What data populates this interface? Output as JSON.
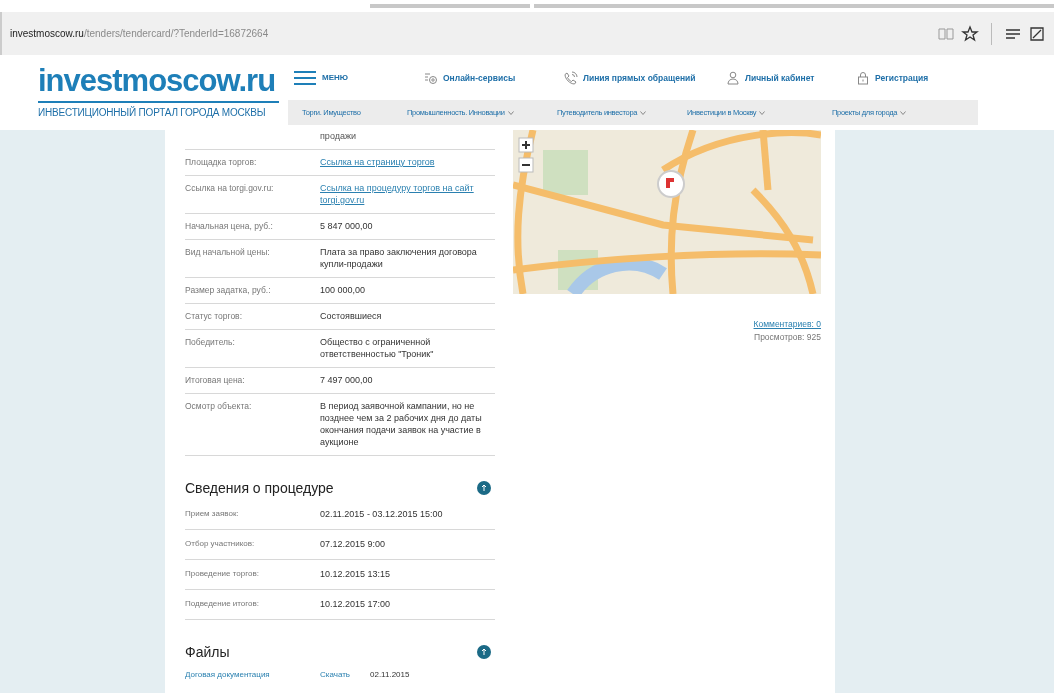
{
  "browser": {
    "url_host": "investmoscow.ru",
    "url_path": "/tenders/tendercard/?TenderId=16872664"
  },
  "header": {
    "logo": "investmoscow.ru",
    "tagline": "ИНВЕСТИЦИОННЫЙ ПОРТАЛ ГОРОДА МОСКВЫ",
    "menu_label": "МЕНЮ",
    "top_links": [
      {
        "kind": "services",
        "label": "Онлайн-сервисы"
      },
      {
        "kind": "phone",
        "label": "Линия прямых обращений"
      },
      {
        "kind": "user",
        "label": "Личный кабинет"
      },
      {
        "kind": "lock",
        "label": "Регистрация"
      }
    ],
    "nav": [
      {
        "label": "Торги. Имущество",
        "dropdown": false
      },
      {
        "label": "Промышленность. Инновации",
        "dropdown": true
      },
      {
        "label": "Путеводитель инвестора",
        "dropdown": true
      },
      {
        "label": "Инвестиции в Москву",
        "dropdown": true
      },
      {
        "label": "Проекты для города",
        "dropdown": true
      }
    ]
  },
  "details": [
    {
      "value": "продажи",
      "kind": "text"
    },
    {
      "label": "Площадка торгов:",
      "value": "Ссылка на страницу торгов",
      "kind": "link"
    },
    {
      "label": "Ссылка на torgi.gov.ru:",
      "value": "Ссылка на процедуру торгов на сайт torgi.gov.ru",
      "kind": "link"
    },
    {
      "label": "Начальная цена, руб.:",
      "value": "5 847 000,00",
      "kind": "text"
    },
    {
      "label": "Вид начальной цены:",
      "value": "Плата за право заключения договора купли-продажи",
      "kind": "text"
    },
    {
      "label": "Размер задатка, руб.:",
      "value": "100 000,00",
      "kind": "text"
    },
    {
      "label": "Статус торгов:",
      "value": "Состоявшиеся",
      "kind": "text"
    },
    {
      "label": "Победитель:",
      "value": "Общество с ограниченной ответственностью \"Троник\"",
      "kind": "text"
    },
    {
      "label": "Итоговая цена:",
      "value": "7 497 000,00",
      "kind": "text"
    },
    {
      "label": "Осмотр объекта:",
      "value": "В период заявочной кампании, но не позднее чем за 2 рабочих дня до даты окончания подачи заявок на участие в аукционе",
      "kind": "text"
    }
  ],
  "procedure": {
    "title": "Сведения о процедуре",
    "rows": [
      {
        "label": "Прием заявок:",
        "value": "02.11.2015 - 03.12.2015 15:00"
      },
      {
        "label": "Отбор участников:",
        "value": "07.12.2015 9:00"
      },
      {
        "label": "Проведение торгов:",
        "value": "10.12.2015 13:15"
      },
      {
        "label": "Подведение итогов:",
        "value": "10.12.2015 17:00"
      }
    ]
  },
  "files": {
    "title": "Файлы",
    "rows": [
      {
        "name": "Договая документация",
        "action": "Скачать",
        "date": "02.11.2015"
      }
    ]
  },
  "side": {
    "comments": "Комментариев: 0",
    "views": "Просмотров: 925"
  }
}
